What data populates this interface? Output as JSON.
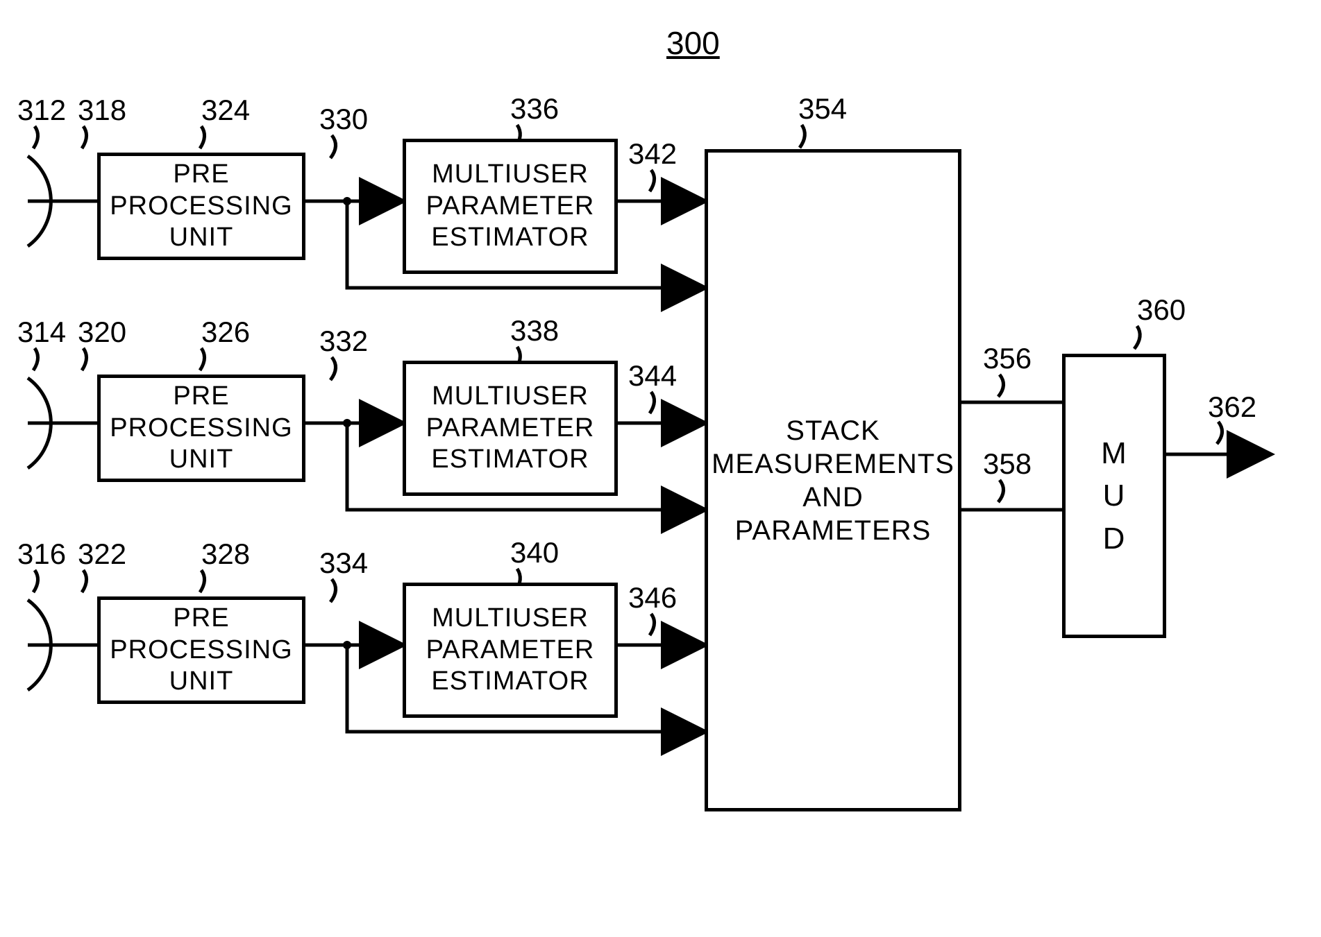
{
  "title": "300",
  "rows": [
    {
      "antenna_ref": "312",
      "antenna_line_ref": "318",
      "ppu_ref": "324",
      "ppu_label": "PRE PROCESSING UNIT",
      "ppu_out_ref": "330",
      "mpe_ref": "336",
      "mpe_label": "MULTIUSER PARAMETER ESTIMATOR",
      "mpe_out_ref": "342"
    },
    {
      "antenna_ref": "314",
      "antenna_line_ref": "320",
      "ppu_ref": "326",
      "ppu_label": "PRE PROCESSING UNIT",
      "ppu_out_ref": "332",
      "mpe_ref": "338",
      "mpe_label": "MULTIUSER PARAMETER ESTIMATOR",
      "mpe_out_ref": "344"
    },
    {
      "antenna_ref": "316",
      "antenna_line_ref": "322",
      "ppu_ref": "328",
      "ppu_label": "PRE PROCESSING UNIT",
      "ppu_out_ref": "334",
      "mpe_ref": "340",
      "mpe_label": "MULTIUSER PARAMETER ESTIMATOR",
      "mpe_out_ref": "346"
    }
  ],
  "stack": {
    "ref": "354",
    "label": "STACK MEASUREMENTS AND PARAMETERS"
  },
  "stack_out_top_ref": "356",
  "stack_out_bottom_ref": "358",
  "mud": {
    "ref": "360",
    "label": "M U D"
  },
  "mud_out_ref": "362"
}
